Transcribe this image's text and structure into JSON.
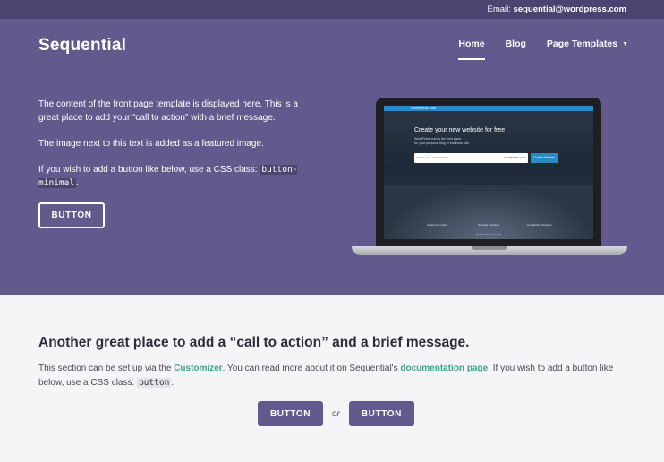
{
  "topbar": {
    "email_label": "Email:",
    "email": "sequential@wordpress.com"
  },
  "site": {
    "title": "Sequential"
  },
  "nav": {
    "items": [
      "Home",
      "Blog",
      "Page Templates"
    ],
    "active": "Home"
  },
  "hero": {
    "paragraph1": "The content of the front page template is displayed here. This is a great place to add your “call to action” with a brief message.",
    "paragraph2": "The image next to this text is added as a featured image.",
    "paragraph3_pre": "If you wish to add a button like below, use a CSS class: ",
    "paragraph3_code": "button-minimal",
    "paragraph3_post": ".",
    "button_label": "BUTTON"
  },
  "laptop_screen": {
    "brand": "WordPress.com",
    "headline": "Create your new website for free",
    "sub1": "WordPress.com is the best place",
    "sub2": "for your personal blog or business site.",
    "input_placeholder": "enter your site address",
    "domain": "wordpress.com",
    "button": "Create Website",
    "features": [
      "Ready for mobile",
      "Security Focused",
      "Hundreds of designs"
    ],
    "footer": "Need more reasons?"
  },
  "cta": {
    "heading": "Another great place to add a “call to action” and a brief message.",
    "text1": "This section can be set up via the ",
    "link1": "Customizer",
    "text2": ". You can read more about it on Sequential's ",
    "link2": "documentation page",
    "text3": ". If you wish to add a button like below, use a CSS class: ",
    "code": "button",
    "text4": ".",
    "button1": "BUTTON",
    "or": "or",
    "button2": "BUTTON"
  },
  "colors": {
    "primary": "#625a8c",
    "topbar": "#4a4470",
    "link": "#3ba58e",
    "background": "#f5f4f7"
  }
}
